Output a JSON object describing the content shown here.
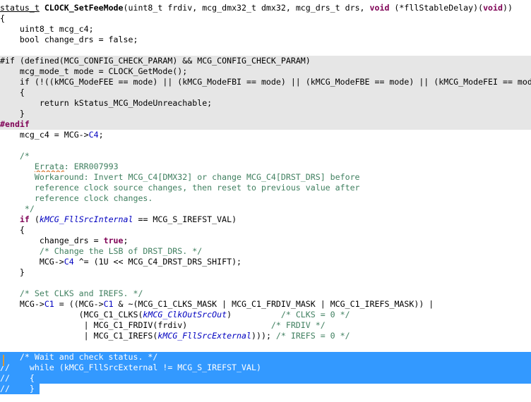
{
  "lines": [
    {
      "cls": "",
      "segs": [
        [
          "status_t",
          "ty"
        ],
        [
          " ",
          ""
        ],
        [
          "CLOCK_SetFeeMode",
          "fn"
        ],
        [
          "(uint8_t frdiv, mcg_dmx32_t dmx32, mcg_drs_t drs, ",
          ""
        ],
        [
          "void",
          "kw"
        ],
        [
          " (*fllStableDelay)(",
          ""
        ],
        [
          "void",
          "kw"
        ],
        [
          "))",
          ""
        ]
      ]
    },
    {
      "cls": "",
      "segs": [
        [
          "{",
          ""
        ]
      ]
    },
    {
      "cls": "",
      "segs": [
        [
          "    uint8_t mcg_c4;",
          ""
        ]
      ]
    },
    {
      "cls": "",
      "segs": [
        [
          "    bool change_drs = false;",
          ""
        ]
      ]
    },
    {
      "cls": "",
      "segs": [
        [
          "",
          ""
        ]
      ]
    },
    {
      "cls": "inactive",
      "segs": [
        [
          "#if",
          ""
        ],
        [
          " (defined(MCG_CONFIG_CHECK_PARAM) && MCG_CONFIG_CHECK_PARAM)",
          ""
        ]
      ]
    },
    {
      "cls": "inactive",
      "segs": [
        [
          "    mcg_mode_t mode = CLOCK_GetMode();",
          ""
        ]
      ]
    },
    {
      "cls": "inactive",
      "segs": [
        [
          "    ",
          ""
        ],
        [
          "if",
          ""
        ],
        [
          " (!((kMCG_ModeFEE == mode) || (kMCG_ModeFBI == mode) || (kMCG_ModeFBE == mode) || (kMCG_ModeFEI == mode)))",
          ""
        ]
      ]
    },
    {
      "cls": "inactive",
      "segs": [
        [
          "    {",
          ""
        ]
      ]
    },
    {
      "cls": "inactive",
      "segs": [
        [
          "        ",
          ""
        ],
        [
          "return",
          ""
        ],
        [
          " kStatus_MCG_ModeUnreachable;",
          ""
        ]
      ]
    },
    {
      "cls": "inactive",
      "segs": [
        [
          "    }",
          ""
        ]
      ]
    },
    {
      "cls": "inactive",
      "segs": [
        [
          "#endif",
          "pp"
        ]
      ]
    },
    {
      "cls": "",
      "segs": [
        [
          "    mcg_c4 = MCG->",
          ""
        ],
        [
          "C4",
          "fd"
        ],
        [
          ";",
          ""
        ]
      ]
    },
    {
      "cls": "",
      "segs": [
        [
          "",
          ""
        ]
      ]
    },
    {
      "cls": "",
      "segs": [
        [
          "    /*",
          "cm"
        ]
      ]
    },
    {
      "cls": "",
      "segs": [
        [
          "       ",
          "cm"
        ],
        [
          "Errata",
          "cm er"
        ],
        [
          ": ERR007993",
          "cm"
        ]
      ]
    },
    {
      "cls": "",
      "segs": [
        [
          "       Workaround: Invert MCG_C4[DMX32] or change MCG_C4[DRST_DRS] before",
          "cm"
        ]
      ]
    },
    {
      "cls": "",
      "segs": [
        [
          "       reference clock source changes, then reset to previous value after",
          "cm"
        ]
      ]
    },
    {
      "cls": "",
      "segs": [
        [
          "       reference clock changes.",
          "cm"
        ]
      ]
    },
    {
      "cls": "",
      "segs": [
        [
          "     */",
          "cm"
        ]
      ]
    },
    {
      "cls": "",
      "segs": [
        [
          "    ",
          ""
        ],
        [
          "if",
          "kw"
        ],
        [
          " (",
          ""
        ],
        [
          "kMCG_FllSrcInternal",
          "en"
        ],
        [
          " == MCG_S_IREFST_VAL)",
          ""
        ]
      ]
    },
    {
      "cls": "",
      "segs": [
        [
          "    {",
          ""
        ]
      ]
    },
    {
      "cls": "",
      "segs": [
        [
          "        change_drs = ",
          ""
        ],
        [
          "true",
          "kw"
        ],
        [
          ";",
          ""
        ]
      ]
    },
    {
      "cls": "",
      "segs": [
        [
          "        ",
          ""
        ],
        [
          "/* Change the LSB of DRST_DRS. */",
          "cm"
        ]
      ]
    },
    {
      "cls": "",
      "segs": [
        [
          "        MCG->",
          ""
        ],
        [
          "C4",
          "fd"
        ],
        [
          " ^= (1U << MCG_C4_DRST_DRS_SHIFT);",
          ""
        ]
      ]
    },
    {
      "cls": "",
      "segs": [
        [
          "    }",
          ""
        ]
      ]
    },
    {
      "cls": "",
      "segs": [
        [
          "",
          ""
        ]
      ]
    },
    {
      "cls": "",
      "segs": [
        [
          "    ",
          ""
        ],
        [
          "/* Set CLKS and IREFS. */",
          "cm"
        ]
      ]
    },
    {
      "cls": "",
      "segs": [
        [
          "    MCG->",
          ""
        ],
        [
          "C1",
          "fd"
        ],
        [
          " = ((MCG->",
          ""
        ],
        [
          "C1",
          "fd"
        ],
        [
          " & ~(MCG_C1_CLKS_MASK | MCG_C1_FRDIV_MASK | MCG_C1_IREFS_MASK)) |",
          ""
        ]
      ]
    },
    {
      "cls": "",
      "segs": [
        [
          "                (MCG_C1_CLKS(",
          ""
        ],
        [
          "kMCG_ClkOutSrcOut",
          "en"
        ],
        [
          ")          ",
          ""
        ],
        [
          "/* CLKS = 0 */",
          "cm"
        ]
      ]
    },
    {
      "cls": "",
      "segs": [
        [
          "                 | MCG_C1_FRDIV(frdiv)                 ",
          ""
        ],
        [
          "/* FRDIV */",
          "cm"
        ]
      ]
    },
    {
      "cls": "",
      "segs": [
        [
          "                 | MCG_C1_IREFS(",
          ""
        ],
        [
          "kMCG_FllSrcExternal",
          "en"
        ],
        [
          "))); ",
          ""
        ],
        [
          "/* IREFS = 0 */",
          "cm"
        ]
      ]
    },
    {
      "cls": "",
      "segs": [
        [
          "",
          ""
        ]
      ]
    },
    {
      "cls": "selected",
      "segs": [
        [
          "    /* Wait and check status. */",
          ""
        ]
      ]
    },
    {
      "cls": "selected",
      "segs": [
        [
          "//    while (kMCG_FllSrcExternal != MCG_S_IREFST_VAL)",
          ""
        ]
      ]
    },
    {
      "cls": "selected",
      "segs": [
        [
          "//    {",
          ""
        ]
      ]
    },
    {
      "cls": "caret",
      "segs": [
        [
          "//    }",
          ""
        ]
      ]
    }
  ]
}
